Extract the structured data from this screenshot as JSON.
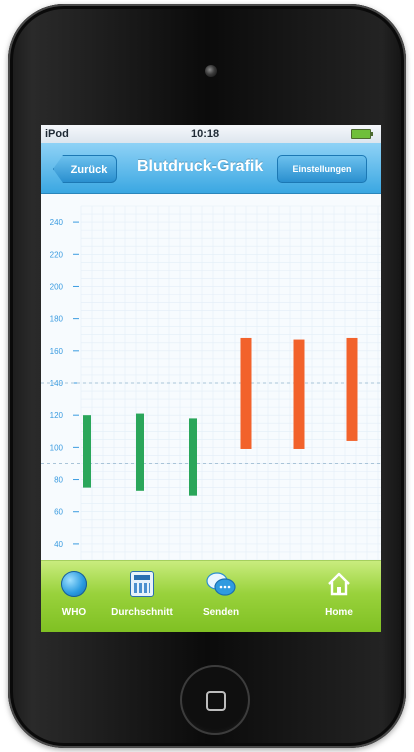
{
  "status": {
    "carrier": "iPod",
    "time": "10:18"
  },
  "nav": {
    "back": "Zurück",
    "title": "Blutdruck-Grafik",
    "settings": "Einstellungen"
  },
  "tabs": [
    {
      "label": "WHO",
      "icon": "globe-icon"
    },
    {
      "label": "Durchschnitt",
      "icon": "calculator-icon"
    },
    {
      "label": "Senden",
      "icon": "chat-bubbles-icon"
    },
    {
      "label": "Home",
      "icon": "house-icon"
    }
  ],
  "colors": {
    "low": "#2aa65a",
    "high": "#f2622b",
    "axis": "#3a9be0"
  },
  "chart_data": {
    "type": "bar",
    "ylim": [
      30,
      250
    ],
    "yticks": [
      40,
      60,
      80,
      100,
      120,
      140,
      160,
      180,
      200,
      220,
      240
    ],
    "dashed_reference_lines": [
      90,
      140
    ],
    "bars": [
      {
        "low": 75,
        "high": 120,
        "color": "#2aa65a"
      },
      {
        "low": 73,
        "high": 121,
        "color": "#2aa65a"
      },
      {
        "low": 70,
        "high": 118,
        "color": "#2aa65a"
      },
      {
        "low": 99,
        "high": 168,
        "color": "#f2622b"
      },
      {
        "low": 99,
        "high": 167,
        "color": "#f2622b"
      },
      {
        "low": 104,
        "high": 168,
        "color": "#f2622b"
      }
    ]
  }
}
